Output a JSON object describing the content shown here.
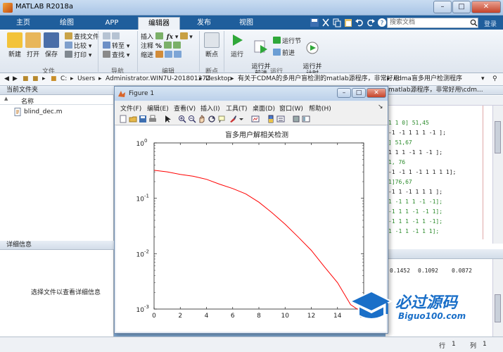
{
  "app": {
    "title": "MATLAB R2018a"
  },
  "window_controls": {
    "minimize": "–",
    "maximize": "□",
    "close": "✕"
  },
  "tabs": [
    {
      "label": "主页"
    },
    {
      "label": "绘图"
    },
    {
      "label": "APP"
    },
    {
      "label": "编辑器"
    },
    {
      "label": "发布"
    },
    {
      "label": "视图"
    }
  ],
  "search": {
    "placeholder": "搜索文档"
  },
  "collapse_label": "登录",
  "ribbon": {
    "file_group": {
      "label": "文件",
      "new": "新建",
      "open": "打开",
      "save": "保存",
      "find_files": "查找文件",
      "compare": "比较",
      "print": "打印"
    },
    "nav_group": {
      "label": "导航",
      "goto": "转至",
      "find": "查找"
    },
    "edit_group": {
      "label": "编辑",
      "insert": "插入",
      "comment": "注释",
      "indent": "缩进",
      "fx": "fx"
    },
    "breakpoint_group": {
      "label": "断点",
      "breakpoints": "断点"
    },
    "run_group": {
      "label": "运行",
      "run": "运行",
      "run_advance": "运行并\n前进",
      "run_section": "运行节",
      "advance": "前进",
      "run_time": "运行并\n计时"
    }
  },
  "address": {
    "drive": "C:",
    "parts": [
      "Users",
      "Administrator.WIN7U-20180127Z",
      "Desktop",
      "有关于CDMA的多用户盲检测的matlab源程序，非常好用",
      "cdma盲多用户检测程序"
    ]
  },
  "left_panel": {
    "header": "当前文件夹",
    "column_name": "名称",
    "sort_arrow": "▲",
    "files": [
      {
        "name": "blind_dec.m"
      }
    ],
    "details_header": "详细信息",
    "details_hint": "选择文件以查看详细信息"
  },
  "right_panel": {
    "title_fragment": "matlab源程序，非常好用\\cdm...",
    "code_lines": [
      "1 1 0]  51,45",
      "-1 -1 1 1 1 -1 ];",
      "] 51,67",
      "1 1 1 -1 1 -1 ];",
      "1, 76",
      "-1 -1 1 -1 1 1 1 1];",
      "1]76,67",
      "-1 1 -1 1 1 1 ];",
      "1 -1 1 1 -1 -1];",
      "-1 1 1 -1 -1 1];",
      "-1 1 1 -1 1 -1];",
      "1 -1 1 -1 1 1];"
    ],
    "output_values": [
      "0.1452",
      "0.1092",
      "0.0872"
    ]
  },
  "figure": {
    "title": "Figure 1",
    "menu": [
      "文件(F)",
      "编辑(E)",
      "查看(V)",
      "插入(I)",
      "工具(T)",
      "桌面(D)",
      "窗口(W)",
      "帮助(H)"
    ],
    "menu_arrow": "↘"
  },
  "chart_data": {
    "type": "line",
    "title": "盲多用户解相关检测",
    "xlabel": "",
    "ylabel": "",
    "xlim": [
      0,
      16
    ],
    "ylim": [
      0.001,
      1
    ],
    "yscale": "log",
    "grid": false,
    "x_ticks": [
      "0",
      "2",
      "4",
      "6",
      "8",
      "10",
      "12",
      "14",
      "16"
    ],
    "y_ticks": [
      {
        "base": "10",
        "exp": "0"
      },
      {
        "base": "10",
        "exp": "-1"
      },
      {
        "base": "10",
        "exp": "-2"
      },
      {
        "base": "10",
        "exp": "-3"
      }
    ],
    "series": [
      {
        "color": "#ff0000",
        "x": [
          0,
          1,
          2,
          3,
          4,
          5,
          6,
          7,
          8,
          9,
          10,
          11,
          12,
          13,
          14,
          15,
          15.5,
          16
        ],
        "y": [
          0.32,
          0.3,
          0.27,
          0.25,
          0.22,
          0.18,
          0.15,
          0.12,
          0.085,
          0.055,
          0.034,
          0.02,
          0.0115,
          0.0058,
          0.003,
          0.0012,
          0.0007,
          0.0004
        ]
      }
    ]
  },
  "status": {
    "row_label": "行",
    "row_value": "1",
    "col_label": "列",
    "col_value": "1"
  },
  "watermark": {
    "brand": "必过源码",
    "url": "Biguo100.com"
  },
  "colors": {
    "tab_bar": "#1f5e9c",
    "series": "#ff0000",
    "watermark_blue": "#1a6fc8"
  }
}
